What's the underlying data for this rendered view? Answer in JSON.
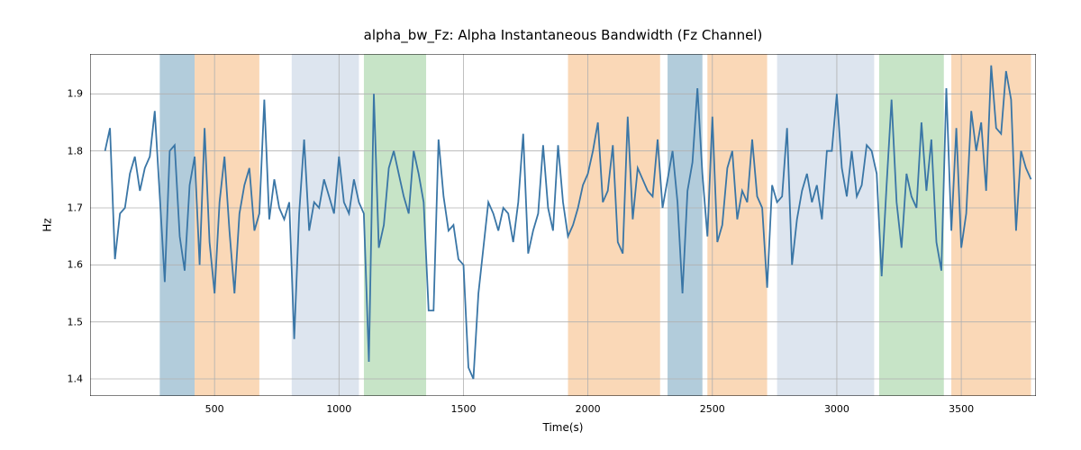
{
  "chart_data": {
    "type": "line",
    "title": "alpha_bw_Fz: Alpha Instantaneous Bandwidth (Fz Channel)",
    "xlabel": "Time(s)",
    "ylabel": "Hz",
    "xlim": [
      0,
      3800
    ],
    "ylim": [
      1.37,
      1.97
    ],
    "x_ticks": [
      500,
      1000,
      1500,
      2000,
      2500,
      3000,
      3500
    ],
    "y_ticks": [
      1.4,
      1.5,
      1.6,
      1.7,
      1.8,
      1.9
    ],
    "bands": [
      {
        "start": 280,
        "end": 420,
        "color": "#6699b8",
        "opacity": 0.5
      },
      {
        "start": 420,
        "end": 680,
        "color": "#f5a85f",
        "opacity": 0.45
      },
      {
        "start": 810,
        "end": 1080,
        "color": "#8fa9c9",
        "opacity": 0.3
      },
      {
        "start": 1100,
        "end": 1350,
        "color": "#8fc98f",
        "opacity": 0.5
      },
      {
        "start": 1920,
        "end": 2290,
        "color": "#f5a85f",
        "opacity": 0.45
      },
      {
        "start": 2320,
        "end": 2460,
        "color": "#6699b8",
        "opacity": 0.5
      },
      {
        "start": 2480,
        "end": 2720,
        "color": "#f5a85f",
        "opacity": 0.45
      },
      {
        "start": 2760,
        "end": 3150,
        "color": "#8fa9c9",
        "opacity": 0.3
      },
      {
        "start": 3170,
        "end": 3430,
        "color": "#8fc98f",
        "opacity": 0.5
      },
      {
        "start": 3460,
        "end": 3780,
        "color": "#f5a85f",
        "opacity": 0.45
      }
    ],
    "series": [
      {
        "name": "alpha_bw_Fz",
        "color": "#3a76a6",
        "x": [
          60,
          80,
          100,
          120,
          140,
          160,
          180,
          200,
          220,
          240,
          260,
          280,
          300,
          320,
          340,
          360,
          380,
          400,
          420,
          440,
          460,
          480,
          500,
          520,
          540,
          560,
          580,
          600,
          620,
          640,
          660,
          680,
          700,
          720,
          740,
          760,
          780,
          800,
          820,
          840,
          860,
          880,
          900,
          920,
          940,
          960,
          980,
          1000,
          1020,
          1040,
          1060,
          1080,
          1100,
          1120,
          1140,
          1160,
          1180,
          1200,
          1220,
          1240,
          1260,
          1280,
          1300,
          1320,
          1340,
          1360,
          1380,
          1400,
          1420,
          1440,
          1460,
          1480,
          1500,
          1520,
          1540,
          1560,
          1580,
          1600,
          1620,
          1640,
          1660,
          1680,
          1700,
          1720,
          1740,
          1760,
          1780,
          1800,
          1820,
          1840,
          1860,
          1880,
          1900,
          1920,
          1940,
          1960,
          1980,
          2000,
          2020,
          2040,
          2060,
          2080,
          2100,
          2120,
          2140,
          2160,
          2180,
          2200,
          2220,
          2240,
          2260,
          2280,
          2300,
          2320,
          2340,
          2360,
          2380,
          2400,
          2420,
          2440,
          2460,
          2480,
          2500,
          2520,
          2540,
          2560,
          2580,
          2600,
          2620,
          2640,
          2660,
          2680,
          2700,
          2720,
          2740,
          2760,
          2780,
          2800,
          2820,
          2840,
          2860,
          2880,
          2900,
          2920,
          2940,
          2960,
          2980,
          3000,
          3020,
          3040,
          3060,
          3080,
          3100,
          3120,
          3140,
          3160,
          3180,
          3200,
          3220,
          3240,
          3260,
          3280,
          3300,
          3320,
          3340,
          3360,
          3380,
          3400,
          3420,
          3440,
          3460,
          3480,
          3500,
          3520,
          3540,
          3560,
          3580,
          3600,
          3620,
          3640,
          3660,
          3680,
          3700,
          3720,
          3740,
          3760,
          3780
        ],
        "y": [
          1.8,
          1.84,
          1.61,
          1.69,
          1.7,
          1.76,
          1.79,
          1.73,
          1.77,
          1.79,
          1.87,
          1.72,
          1.57,
          1.8,
          1.81,
          1.65,
          1.59,
          1.74,
          1.79,
          1.6,
          1.84,
          1.64,
          1.55,
          1.71,
          1.79,
          1.66,
          1.55,
          1.69,
          1.74,
          1.77,
          1.66,
          1.69,
          1.89,
          1.68,
          1.75,
          1.7,
          1.68,
          1.71,
          1.47,
          1.69,
          1.82,
          1.66,
          1.71,
          1.7,
          1.75,
          1.72,
          1.69,
          1.79,
          1.71,
          1.69,
          1.75,
          1.71,
          1.69,
          1.43,
          1.9,
          1.63,
          1.67,
          1.77,
          1.8,
          1.76,
          1.72,
          1.69,
          1.8,
          1.76,
          1.71,
          1.52,
          1.52,
          1.82,
          1.72,
          1.66,
          1.67,
          1.61,
          1.6,
          1.42,
          1.4,
          1.55,
          1.63,
          1.71,
          1.69,
          1.66,
          1.7,
          1.69,
          1.64,
          1.71,
          1.83,
          1.62,
          1.66,
          1.69,
          1.81,
          1.7,
          1.66,
          1.81,
          1.71,
          1.65,
          1.67,
          1.7,
          1.74,
          1.76,
          1.8,
          1.85,
          1.71,
          1.73,
          1.81,
          1.64,
          1.62,
          1.86,
          1.68,
          1.77,
          1.75,
          1.73,
          1.72,
          1.82,
          1.7,
          1.75,
          1.8,
          1.71,
          1.55,
          1.73,
          1.78,
          1.91,
          1.76,
          1.65,
          1.86,
          1.64,
          1.67,
          1.77,
          1.8,
          1.68,
          1.73,
          1.71,
          1.82,
          1.72,
          1.7,
          1.56,
          1.74,
          1.71,
          1.72,
          1.84,
          1.6,
          1.68,
          1.73,
          1.76,
          1.71,
          1.74,
          1.68,
          1.8,
          1.8,
          1.9,
          1.77,
          1.72,
          1.8,
          1.72,
          1.74,
          1.81,
          1.8,
          1.76,
          1.58,
          1.74,
          1.89,
          1.71,
          1.63,
          1.76,
          1.72,
          1.7,
          1.85,
          1.73,
          1.82,
          1.64,
          1.59,
          1.91,
          1.66,
          1.84,
          1.63,
          1.69,
          1.87,
          1.8,
          1.85,
          1.73,
          1.95,
          1.84,
          1.83,
          1.94,
          1.89,
          1.66,
          1.8,
          1.77,
          1.75
        ]
      }
    ]
  }
}
